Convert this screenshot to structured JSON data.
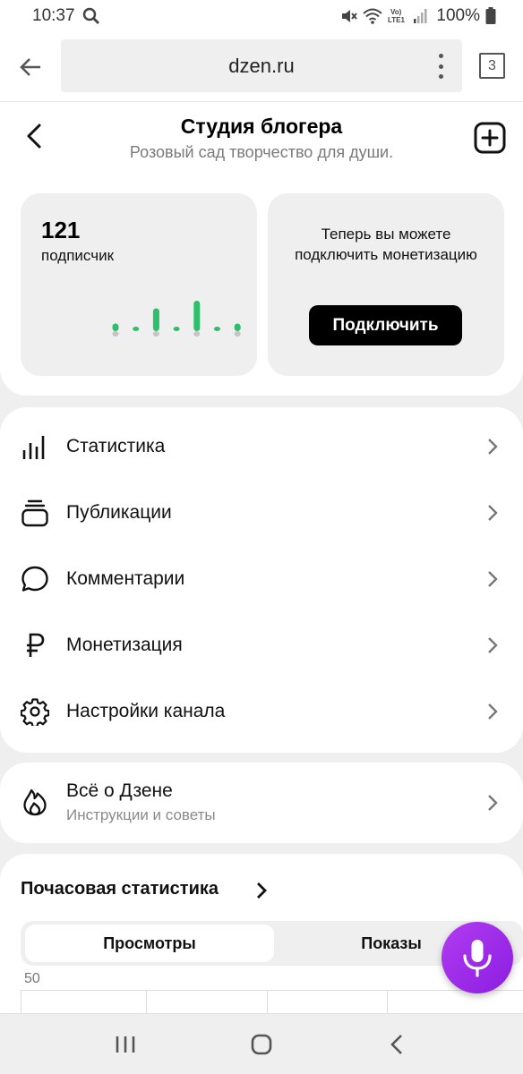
{
  "status_bar": {
    "time": "10:37",
    "battery": "100%"
  },
  "browser": {
    "url": "dzen.ru",
    "tabs_count": "3"
  },
  "header": {
    "title": "Студия блогера",
    "subtitle": "Розовый сад творчество для души."
  },
  "subscribers": {
    "count": "121",
    "label": "подписчик",
    "spark_values": [
      1,
      0,
      3,
      0,
      4,
      0,
      1
    ],
    "spark_color": "#2dbf6c"
  },
  "monetization_card": {
    "text": "Теперь вы можете подключить монетизацию",
    "button_label": "Подключить"
  },
  "menu": {
    "items": [
      {
        "label": "Статистика",
        "icon": "bar-chart-icon"
      },
      {
        "label": "Публикации",
        "icon": "publications-icon"
      },
      {
        "label": "Комментарии",
        "icon": "comment-icon"
      },
      {
        "label": "Монетизация",
        "icon": "ruble-icon"
      },
      {
        "label": "Настройки канала",
        "icon": "gear-icon"
      }
    ]
  },
  "about": {
    "title": "Всё о Дзене",
    "subtitle": "Инструкции и советы",
    "icon": "flame-icon"
  },
  "hourly_stats": {
    "title": "Почасовая статистика",
    "tabs": [
      {
        "label": "Просмотры",
        "active": true
      },
      {
        "label": "Показы",
        "active": false
      }
    ],
    "y_axis_top": "50"
  },
  "colors": {
    "accent_green": "#2dbf6c",
    "mic_purple": "#9b2eea"
  }
}
